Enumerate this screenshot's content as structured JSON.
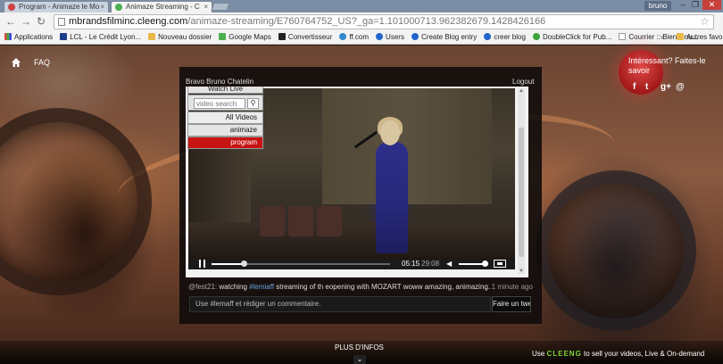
{
  "browser": {
    "tabs": [
      {
        "title": "Program - Animaze le Mo",
        "active": false,
        "favicon_color": "#d04040"
      },
      {
        "title": "Animaze Streaming - C",
        "active": true,
        "favicon_color": "#4caf50"
      }
    ],
    "user": "bruno",
    "url": {
      "host": "mbrandsfilminc.cleeng.com",
      "path": "/animaze-streaming/E760764752_US?_ga=1.101000713.962382679.1428426166"
    },
    "bookmarks": [
      "Applications",
      "LCL - Le Crédit Lyon...",
      "Nouveau dossier",
      "Google Maps",
      "Convertisseur",
      "ff.com",
      "Users",
      "Create Blog entry",
      "creer blog",
      "DoubleClick for Pub...",
      "Courrier :: Bienvenu..."
    ],
    "bookmarks_more": "»",
    "other_bookmarks": "Autres favoris"
  },
  "page": {
    "faq": "FAQ",
    "welcome": "Bravo Bruno Chatelin",
    "logout": "Logout"
  },
  "menu": {
    "top_cut": "Watch Live",
    "search_placeholder": "video search",
    "items": [
      "All Videos",
      "animaze",
      "program"
    ],
    "active_color": "#c81313"
  },
  "player": {
    "time_current": "05:15",
    "time_total": "29:08",
    "progress": 0.18,
    "volume": 0.85
  },
  "comments": {
    "user": "@fest21:",
    "text_before": " watching ",
    "hashtag": "#lemiaff",
    "text_after": " streaming of th eopening with MOZART woww amazing, animazing",
    "time": "...1 minute ago",
    "input_placeholder": "Use #lemaff et rédiger un commentaire.",
    "submit": "Faire un twe"
  },
  "promo": {
    "text": "Intéressant? Faites-le savoir",
    "social": [
      "f",
      "t",
      "g+",
      "@"
    ]
  },
  "footer": {
    "more": "PLUS D'INFOS",
    "pre": "Use",
    "brand": "CLEENG",
    "post": "to sell your videos, Live & On-demand"
  }
}
